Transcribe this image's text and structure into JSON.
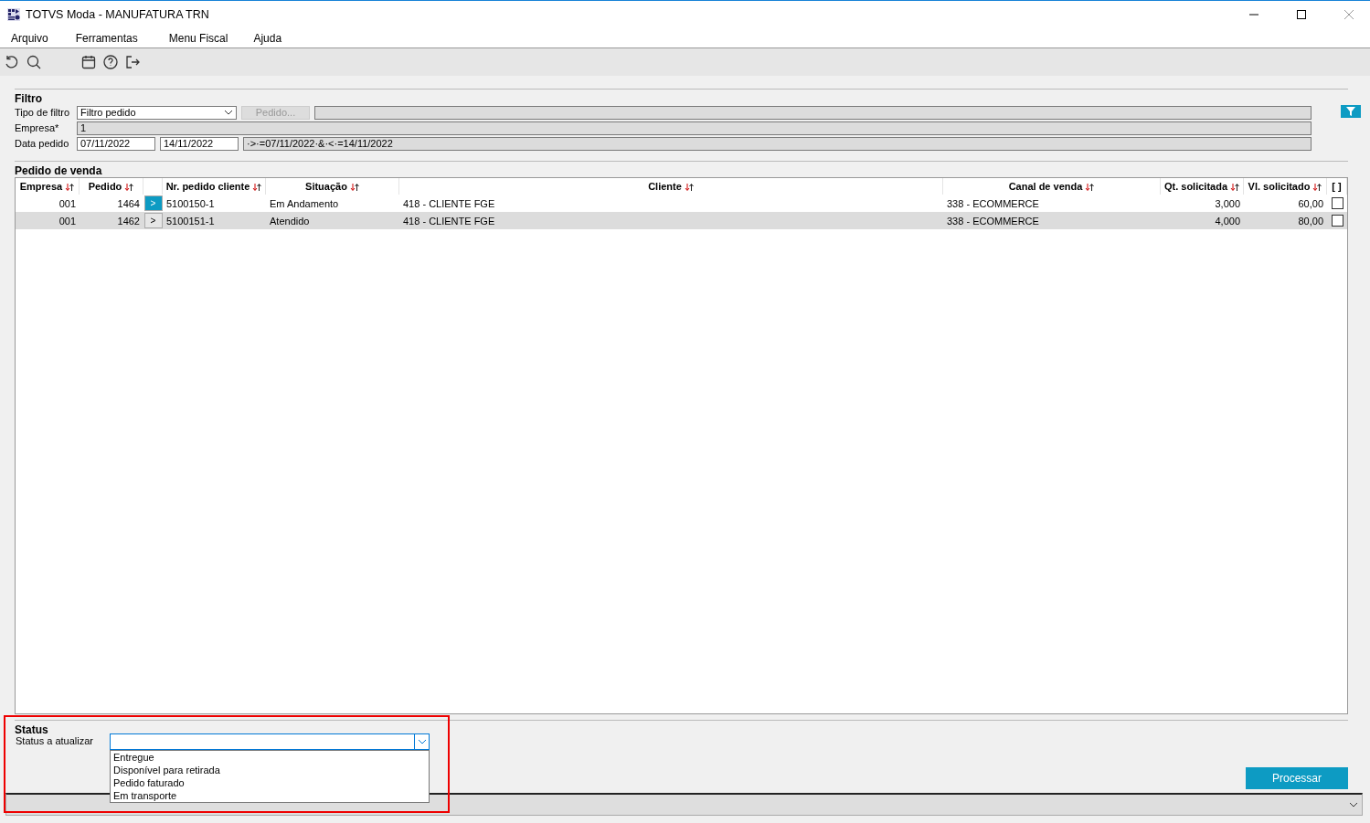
{
  "window": {
    "title": "TOTVS Moda - MANUFATURA TRN"
  },
  "menu": [
    "Arquivo",
    "Ferramentas",
    "Menu Fiscal",
    "Ajuda"
  ],
  "filter": {
    "title": "Filtro",
    "type_label": "Tipo de filtro",
    "type_value": "Filtro pedido",
    "order_button": "Pedido...",
    "order_button_disabled": true,
    "company_label": "Empresa*",
    "company_value": "1",
    "date_label": "Data pedido",
    "date_from": "07/11/2022",
    "date_to": "14/11/2022",
    "expression": "·>·=07/11/2022·&·<·=14/11/2022"
  },
  "orders": {
    "title": "Pedido de venda",
    "columns": [
      {
        "kind": "sortable",
        "label": "Empresa"
      },
      {
        "kind": "sortable",
        "label": "Pedido"
      },
      {
        "kind": "expander"
      },
      {
        "kind": "sortable",
        "label": "Nr. pedido cliente"
      },
      {
        "kind": "sortable",
        "label": "Situação"
      },
      {
        "kind": "sortable",
        "label": "Cliente"
      },
      {
        "kind": "sortable",
        "label": "Canal de venda"
      },
      {
        "kind": "sortable",
        "label": "Qt. solicitada"
      },
      {
        "kind": "sortable",
        "label": "Vl. solicitado"
      },
      {
        "kind": "check",
        "label": "[ ]"
      }
    ],
    "rows": [
      {
        "selected": false,
        "expander_active": true,
        "checked": false,
        "cells": [
          "001",
          "1464",
          ">",
          "5100150-1",
          "Em Andamento",
          "418 - CLIENTE FGE",
          "338 - ECOMMERCE",
          "3,000",
          "60,00"
        ]
      },
      {
        "selected": true,
        "expander_active": false,
        "checked": false,
        "cells": [
          "001",
          "1462",
          ">",
          "5100151-1",
          "Atendido",
          "418 - CLIENTE FGE",
          "338 - ECOMMERCE",
          "4,000",
          "80,00"
        ]
      }
    ]
  },
  "status": {
    "title": "Status",
    "label": "Status a atualizar",
    "expanded": true,
    "options": [
      "Entregue",
      "Disponível para retirada",
      "Pedido faturado",
      "Em transporte"
    ]
  },
  "process_button": "Processar"
}
